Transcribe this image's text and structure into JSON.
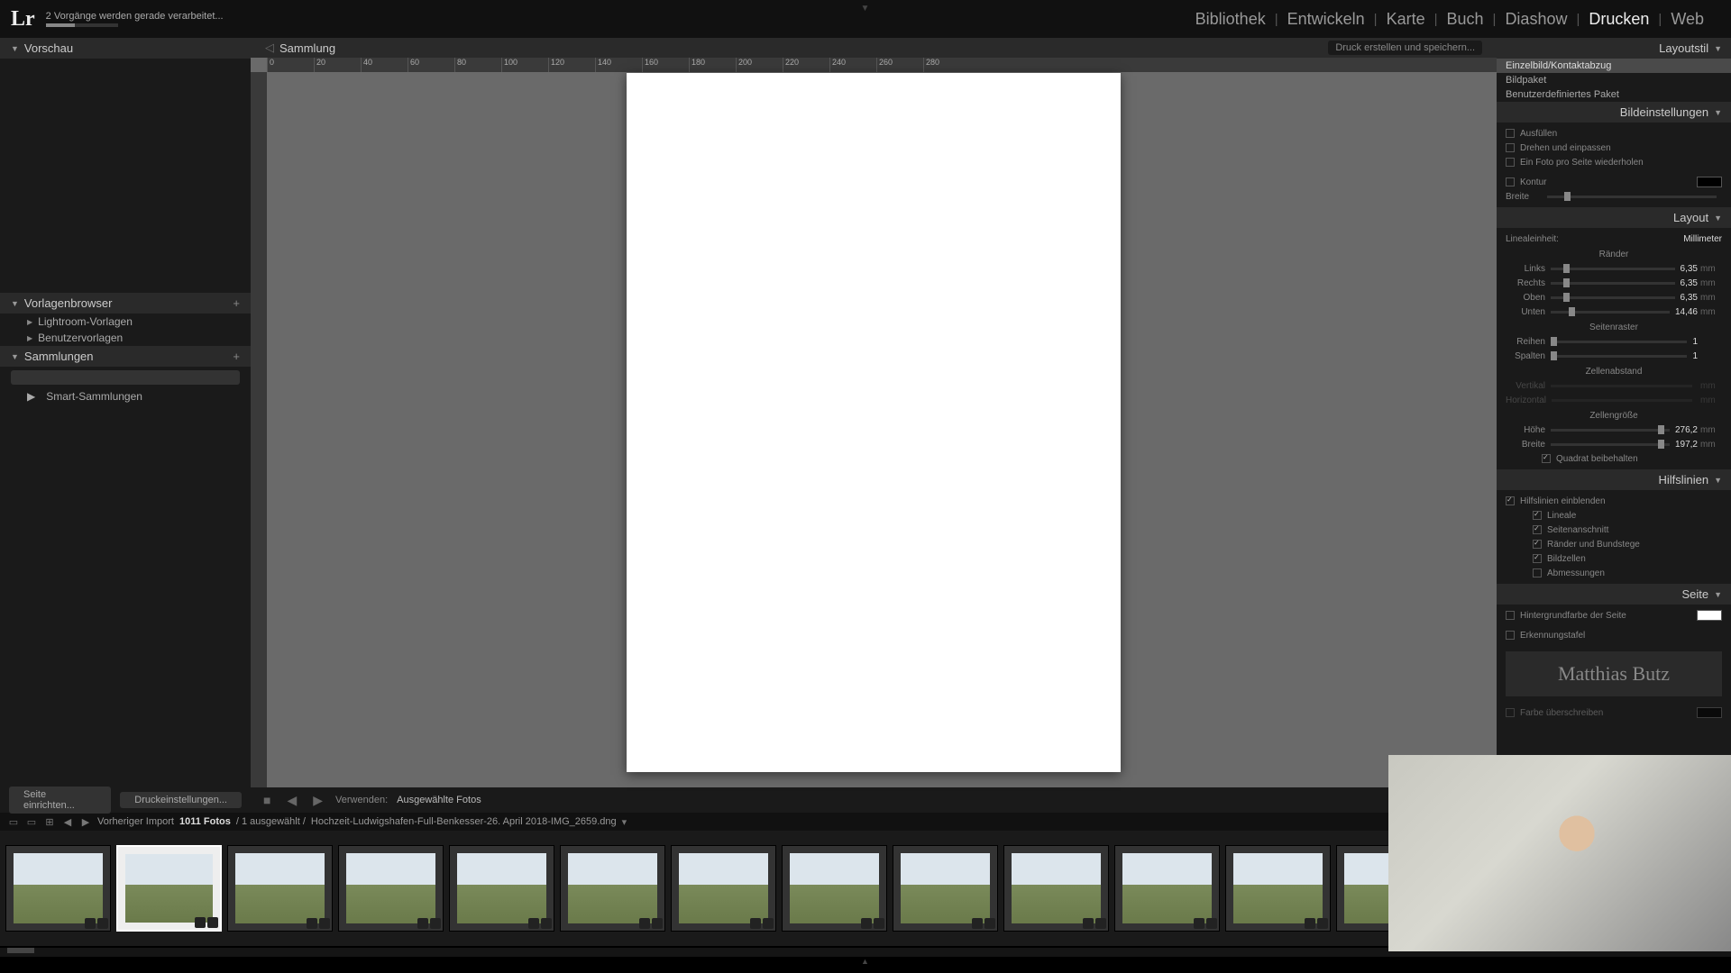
{
  "header": {
    "logo": "Lr",
    "status": "2 Vorgänge werden gerade verarbeitet...",
    "modules": [
      "Bibliothek",
      "Entwickeln",
      "Karte",
      "Buch",
      "Diashow",
      "Drucken",
      "Web"
    ],
    "active_module": "Drucken"
  },
  "left": {
    "preview_title": "Vorschau",
    "template_title": "Vorlagenbrowser",
    "template_items": [
      "Lightroom-Vorlagen",
      "Benutzervorlagen"
    ],
    "collections_title": "Sammlungen",
    "smart_collections": "Smart-Sammlungen"
  },
  "center": {
    "title": "Sammlung",
    "action_btn": "Druck erstellen und speichern...",
    "ruler_marks": [
      "0",
      "20",
      "40",
      "60",
      "80",
      "100",
      "120",
      "140",
      "160",
      "180",
      "200",
      "220",
      "240",
      "260",
      "280"
    ]
  },
  "right": {
    "layout_style_title": "Layoutstil",
    "styles": [
      "Einzelbild/Kontaktabzug",
      "Bildpaket",
      "Benutzerdefiniertes Paket"
    ],
    "image_settings_title": "Bildeinstellungen",
    "image_settings": {
      "fill": "Ausfüllen",
      "rotate": "Drehen und einpassen",
      "repeat": "Ein Foto pro Seite wiederholen",
      "stroke": "Kontur",
      "stroke_width_label": "Breite"
    },
    "layout_title": "Layout",
    "ruler_unit_label": "Linealeinheit:",
    "ruler_unit": "Millimeter",
    "margins_title": "Ränder",
    "margins": {
      "left_label": "Links",
      "left_val": "6,35",
      "right_label": "Rechts",
      "right_val": "6,35",
      "top_label": "Oben",
      "top_val": "6,35",
      "bottom_label": "Unten",
      "bottom_val": "14,46"
    },
    "grid_title": "Seitenraster",
    "rows_label": "Reihen",
    "rows_val": "1",
    "cols_label": "Spalten",
    "cols_val": "1",
    "spacing_title": "Zellenabstand",
    "v_label": "Vertikal",
    "h_label": "Horizontal",
    "cellsize_title": "Zellengröße",
    "height_label": "Höhe",
    "height_val": "276,2",
    "width_label": "Breite",
    "width_val": "197,2",
    "keep_square": "Quadrat beibehalten",
    "guides_title": "Hilfslinien",
    "show_guides": "Hilfslinien einblenden",
    "guide_items": [
      "Lineale",
      "Seitenanschnitt",
      "Ränder und Bundstege",
      "Bildzellen",
      "Abmessungen"
    ],
    "page_title": "Seite",
    "page_bg": "Hintergrundfarbe der Seite",
    "identity_label": "Erkennungstafel",
    "identity_text": "Matthias Butz",
    "override_color": "Farbe überschreiben",
    "unit_mm": "mm"
  },
  "toolbar": {
    "page_setup": "Seite einrichten...",
    "print_settings": "Druckeinstellungen...",
    "use_label": "Verwenden:",
    "use_value": "Ausgewählte Fotos"
  },
  "pathbar": {
    "prev_import": "Vorheriger Import",
    "count": "1011 Fotos",
    "selected": "/ 1 ausgewählt /",
    "path": "Hochzeit-Ludwigshafen-Full-Benkesser-26. April 2018-IMG_2659.dng"
  },
  "filmstrip": {
    "selected_index": 1,
    "count": 16
  }
}
